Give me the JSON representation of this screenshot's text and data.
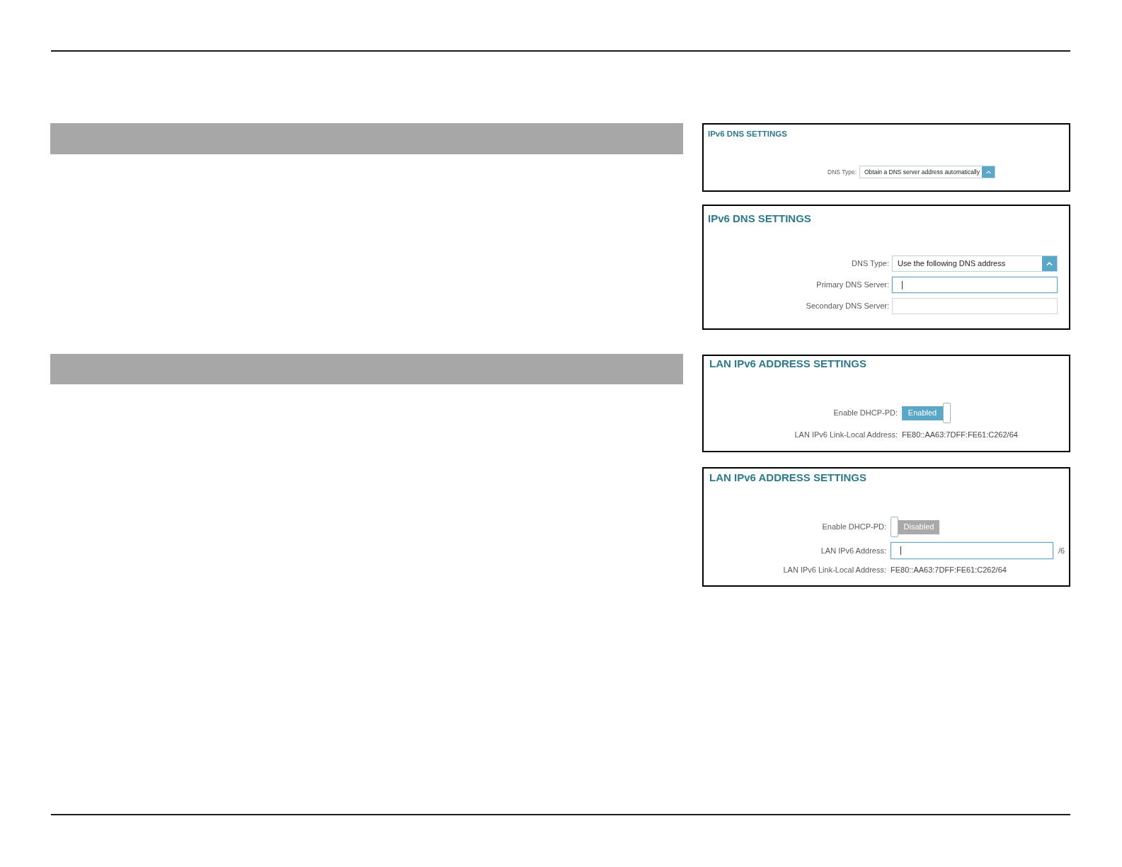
{
  "screenshots": [
    {
      "title": "IPv6 DNS SETTINGS",
      "fields": [
        {
          "kind": "select",
          "label": "DNS Type:",
          "value": "Obtain a DNS server address automatically"
        }
      ]
    },
    {
      "title": "IPv6 DNS SETTINGS",
      "fields": [
        {
          "kind": "select",
          "label": "DNS Type:",
          "value": "Use the following DNS address"
        },
        {
          "kind": "input",
          "label": "Primary DNS Server:",
          "focused": true
        },
        {
          "kind": "input",
          "label": "Secondary DNS Server:",
          "focused": false
        }
      ]
    },
    {
      "title": "LAN IPv6 ADDRESS SETTINGS",
      "fields": [
        {
          "kind": "toggle",
          "label": "Enable DHCP-PD:",
          "on": true,
          "text": "Enabled"
        },
        {
          "kind": "info",
          "label": "LAN IPv6 Link-Local Address:",
          "value": "FE80::AA63:7DFF:FE61:C262/64"
        }
      ]
    },
    {
      "title": "LAN IPv6 ADDRESS SETTINGS",
      "fields": [
        {
          "kind": "toggle",
          "label": "Enable DHCP-PD:",
          "on": false,
          "text": "Disabled"
        },
        {
          "kind": "input",
          "label": "LAN IPv6 Address:",
          "focused": true,
          "suffix": "/6"
        },
        {
          "kind": "info",
          "label": "LAN IPv6 Link-Local Address:",
          "value": "FE80::AA63:7DFF:FE61:C262/64"
        }
      ]
    }
  ]
}
